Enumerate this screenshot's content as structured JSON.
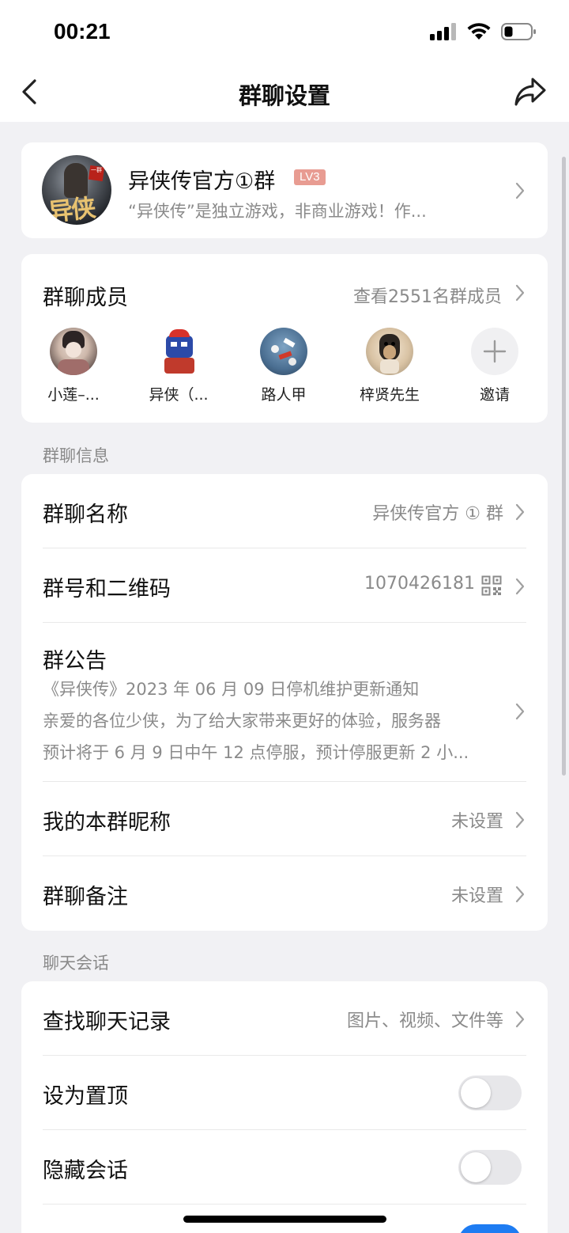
{
  "status": {
    "time": "00:21"
  },
  "nav": {
    "title": "群聊设置"
  },
  "group": {
    "name": "异侠传官方①群",
    "level": "LV3",
    "description": "“异侠传”是独立游戏，非商业游戏！作...",
    "avatar_text_top": "一群",
    "avatar_text": "异侠"
  },
  "members": {
    "title": "群聊成员",
    "view_all": "查看2551名群成员",
    "list": [
      {
        "name": "小莲–..."
      },
      {
        "name": "异侠（..."
      },
      {
        "name": "路人甲"
      },
      {
        "name": "梓贤先生"
      },
      {
        "name": "邀请"
      }
    ]
  },
  "info_section": {
    "header": "群聊信息",
    "name_label": "群聊名称",
    "name_value": "异侠传官方 ① 群",
    "id_label": "群号和二维码",
    "id_value": "1070426181",
    "notice_label": "群公告",
    "notice_lines": [
      "《异侠传》2023 年 06 月 09 日停机维护更新通知",
      "亲爱的各位少侠，为了给大家带来更好的体验，服务器",
      "预计将于 6 月 9 日中午 12 点停服，预计停服更新 2 小..."
    ],
    "nickname_label": "我的本群昵称",
    "nickname_value": "未设置",
    "remark_label": "群聊备注",
    "remark_value": "未设置"
  },
  "chat_section": {
    "header": "聊天会话",
    "search_label": "查找聊天记录",
    "search_value": "图片、视频、文件等",
    "pin_label": "设为置顶",
    "pin_on": false,
    "hide_label": "隐藏会话",
    "hide_on": false
  },
  "colors": {
    "background": "#f1f1f4",
    "level_badge": "#e89c92",
    "toggle_off": "#e7e7ea",
    "toggle_on": "#1e7cf2"
  }
}
